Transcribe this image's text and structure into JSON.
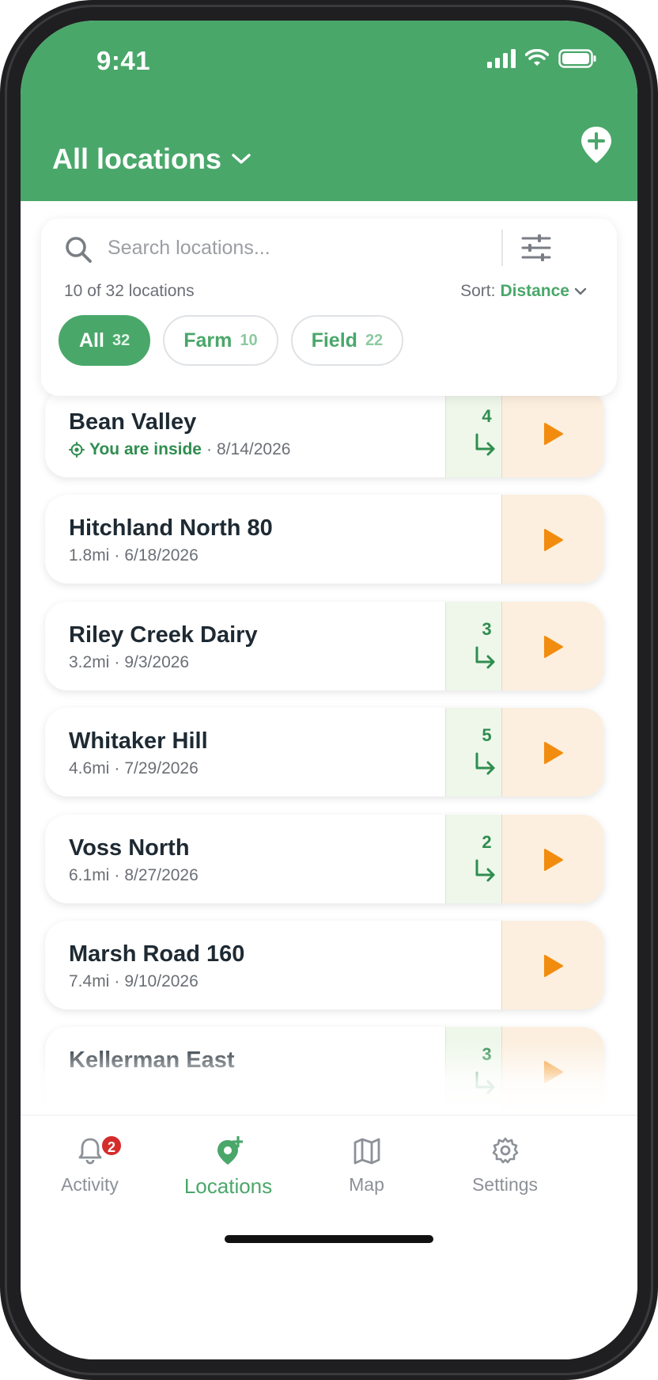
{
  "status": {
    "time": "9:41"
  },
  "header": {
    "title": "All locations"
  },
  "search": {
    "placeholder": "Search locations...",
    "count_text": "10 of 32 locations",
    "sort_label": "Sort:",
    "sort_value": "Distance"
  },
  "chips": [
    {
      "label": "All",
      "count": "32",
      "active": true
    },
    {
      "label": "Farm",
      "count": "10",
      "active": false
    },
    {
      "label": "Field",
      "count": "22",
      "active": false
    }
  ],
  "locations": [
    {
      "name": "Bean Valley",
      "inside_text": "You are inside",
      "distance": "",
      "date": "8/14/2026",
      "sub_count": "4"
    },
    {
      "name": "Hitchland North 80",
      "inside_text": "",
      "distance": "1.8mi",
      "date": "6/18/2026",
      "sub_count": ""
    },
    {
      "name": "Riley Creek Dairy",
      "inside_text": "",
      "distance": "3.2mi",
      "date": "9/3/2026",
      "sub_count": "3"
    },
    {
      "name": "Whitaker Hill",
      "inside_text": "",
      "distance": "4.6mi",
      "date": "7/29/2026",
      "sub_count": "5"
    },
    {
      "name": "Voss North",
      "inside_text": "",
      "distance": "6.1mi",
      "date": "8/27/2026",
      "sub_count": "2"
    },
    {
      "name": "Marsh Road 160",
      "inside_text": "",
      "distance": "7.4mi",
      "date": "9/10/2026",
      "sub_count": ""
    },
    {
      "name": "Kellerman East",
      "inside_text": "",
      "distance": "",
      "date": "",
      "sub_count": "3"
    }
  ],
  "tabs": [
    {
      "label": "Activity",
      "icon": "bell-icon",
      "badge": "2",
      "active": false
    },
    {
      "label": "Locations",
      "icon": "location-add-icon",
      "badge": "",
      "active": true
    },
    {
      "label": "Map",
      "icon": "map-icon",
      "badge": "",
      "active": false
    },
    {
      "label": "Settings",
      "icon": "gear-icon",
      "badge": "",
      "active": false
    }
  ],
  "colors": {
    "brand_green": "#4aa76a",
    "play_orange": "#f28c0f",
    "badge_red": "#d62b2b"
  }
}
